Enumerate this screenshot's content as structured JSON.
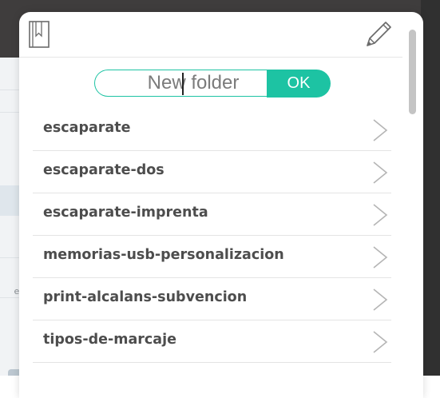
{
  "new_folder": {
    "input_placeholder": "New folder",
    "input_value": "",
    "ok_label": "OK"
  },
  "folders": [
    {
      "label": "escaparate"
    },
    {
      "label": "escaparate-dos"
    },
    {
      "label": "escaparate-imprenta"
    },
    {
      "label": "memorias-usb-personalizacion"
    },
    {
      "label": "print-alcalans-subvencion"
    },
    {
      "label": "tipos-de-marcaje"
    }
  ],
  "background": {
    "left_fragment": "es"
  },
  "icons": {
    "header_left": "bookmark-icon",
    "header_right": "pencil-icon",
    "row_action": "chevron-right-icon"
  },
  "colors": {
    "accent": "#1dc3a3",
    "text": "#4d4d4d",
    "placeholder": "#7b7b7b",
    "divider": "#e4e4e4",
    "scrollbar": "#c4c4c4"
  }
}
